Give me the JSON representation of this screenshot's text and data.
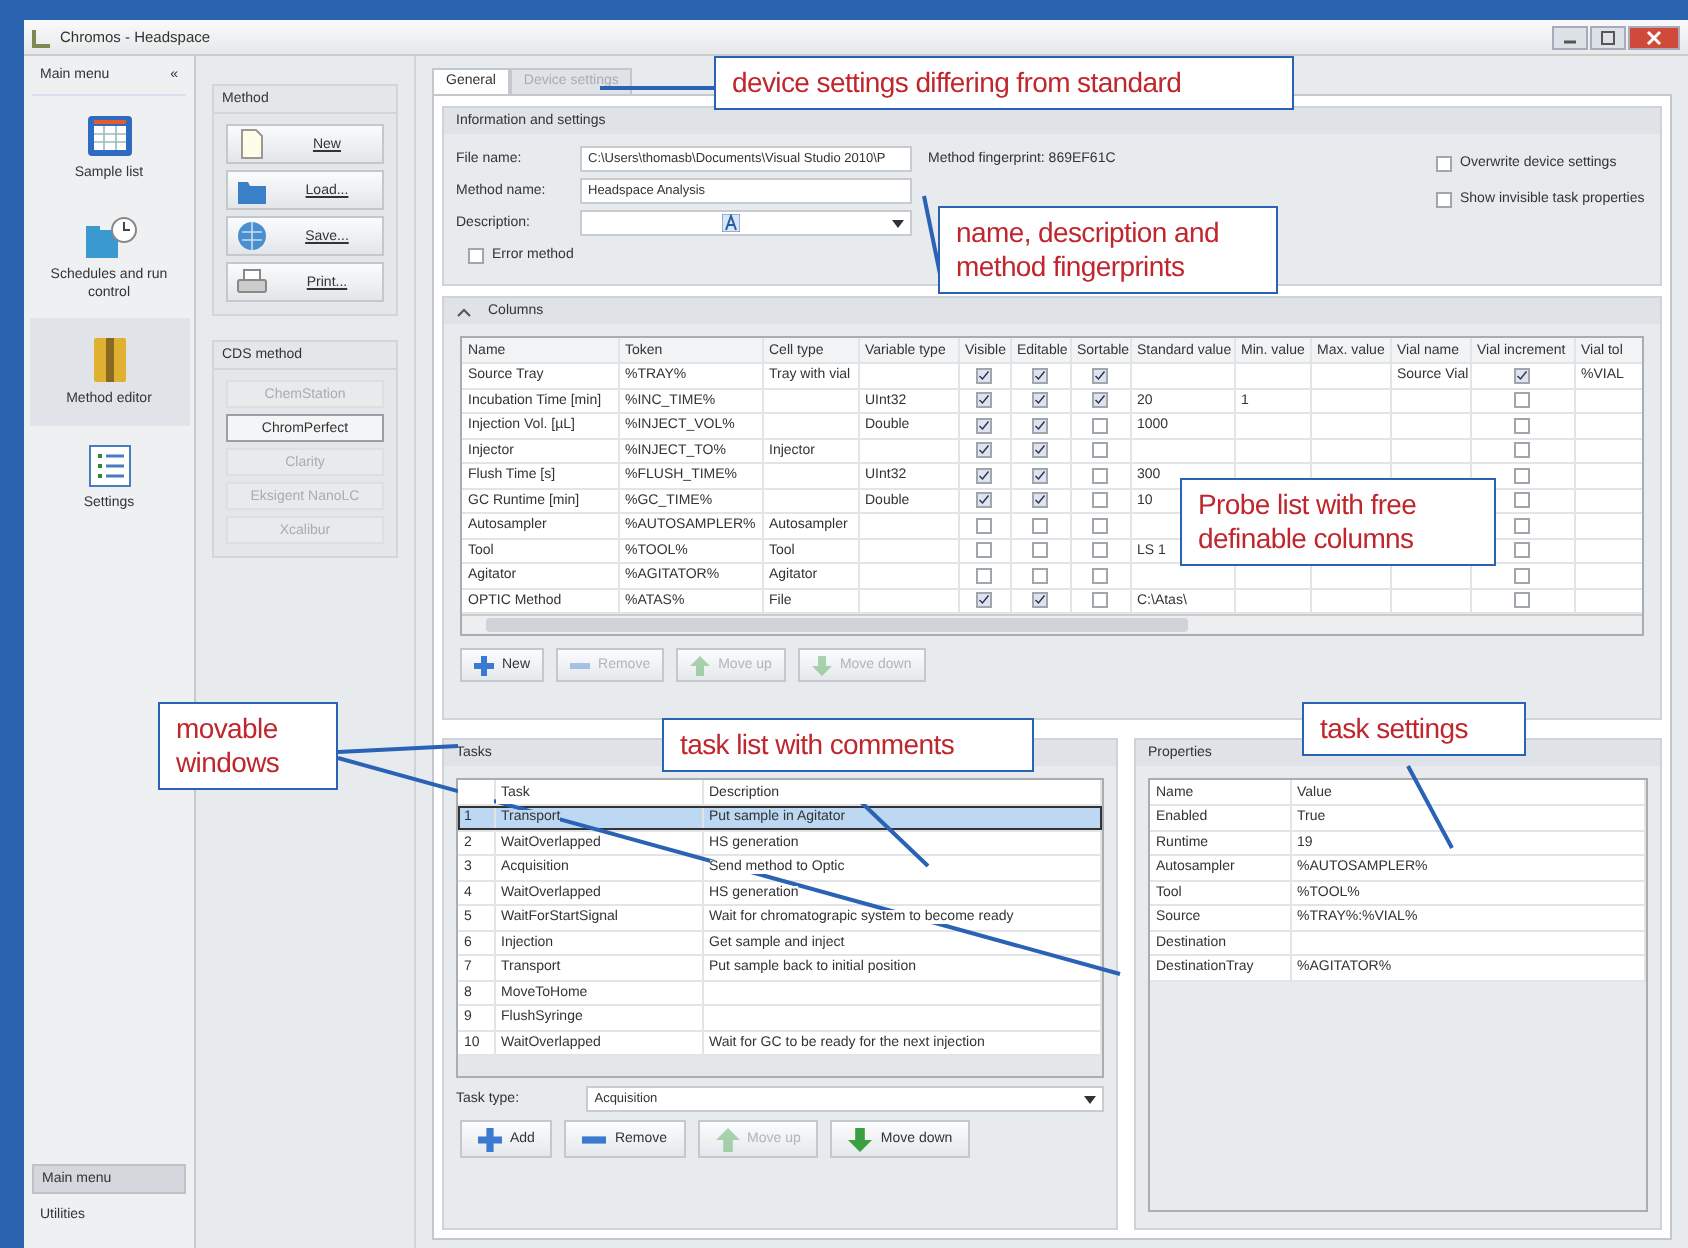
{
  "window": {
    "title": "Chromos - Headspace"
  },
  "sidebar": {
    "title": "Main menu",
    "collapse": "«",
    "items": [
      {
        "label": "Sample list",
        "selected": false
      },
      {
        "label": "Schedules and run control",
        "selected": false
      },
      {
        "label": "Method editor",
        "selected": true
      },
      {
        "label": "Settings",
        "selected": false
      }
    ],
    "bottom_items": [
      {
        "label": "Main menu",
        "selected": true
      },
      {
        "label": "Utilities",
        "selected": false
      }
    ]
  },
  "method_group": {
    "title": "Method",
    "buttons": [
      "New",
      "Load...",
      "Save...",
      "Print..."
    ]
  },
  "cds_group": {
    "title": "CDS method",
    "items": [
      {
        "label": "ChemStation",
        "selected": false
      },
      {
        "label": "ChromPerfect",
        "selected": true
      },
      {
        "label": "Clarity",
        "selected": false
      },
      {
        "label": "Eksigent NanoLC",
        "selected": false
      },
      {
        "label": "Xcalibur",
        "selected": false
      }
    ]
  },
  "tabs": [
    {
      "label": "General",
      "selected": true
    },
    {
      "label": "Device settings",
      "selected": false
    }
  ],
  "info": {
    "title": "Information and settings",
    "fields": [
      {
        "label": "File name:",
        "value": "C:\\Users\\thomasb\\Documents\\Visual Studio 2010\\P",
        "kind": "text"
      },
      {
        "label": "Method name:",
        "value": "Headspace Analysis",
        "kind": "text"
      },
      {
        "label": "Description:",
        "kind": "description"
      }
    ],
    "fingerprint": "Method fingerprint: 869EF61C",
    "error_method": {
      "label": "Error method",
      "checked": false
    },
    "options": [
      {
        "label": "Overwrite device settings",
        "checked": false
      },
      {
        "label": "Show invisible task properties",
        "checked": false
      }
    ]
  },
  "columns_group": {
    "title": "Columns",
    "expanded": true,
    "columns": [
      {
        "label": "Name",
        "kind": "text"
      },
      {
        "label": "Token",
        "kind": "text"
      },
      {
        "label": "Cell type",
        "kind": "text"
      },
      {
        "label": "Variable type",
        "kind": "text"
      },
      {
        "label": "Visible",
        "kind": "check"
      },
      {
        "label": "Editable",
        "kind": "check"
      },
      {
        "label": "Sortable",
        "kind": "check"
      },
      {
        "label": "Standard value",
        "kind": "text"
      },
      {
        "label": "Min. value",
        "kind": "text"
      },
      {
        "label": "Max. value",
        "kind": "text"
      },
      {
        "label": "Vial name",
        "kind": "text"
      },
      {
        "label": "Vial increment",
        "kind": "check"
      },
      {
        "label": "Vial tol",
        "kind": "text"
      }
    ],
    "rows": [
      {
        "cells": [
          "Source Tray",
          "%TRAY%",
          "Tray with vial",
          null,
          true,
          true,
          true,
          null,
          null,
          null,
          "Source Vial",
          true,
          "%VIAL"
        ]
      },
      {
        "cells": [
          "Incubation Time [min]",
          "%INC_TIME%",
          null,
          "UInt32",
          true,
          true,
          true,
          "20",
          "1",
          null,
          null,
          false,
          null
        ]
      },
      {
        "cells": [
          "Injection Vol. [µL]",
          "%INJECT_VOL%",
          null,
          "Double",
          true,
          true,
          false,
          "1000",
          null,
          null,
          null,
          false,
          null
        ]
      },
      {
        "cells": [
          "Injector",
          "%INJECT_TO%",
          "Injector",
          null,
          true,
          true,
          false,
          null,
          null,
          null,
          null,
          false,
          null
        ]
      },
      {
        "cells": [
          "Flush Time [s]",
          "%FLUSH_TIME%",
          null,
          "UInt32",
          true,
          true,
          false,
          "300",
          null,
          null,
          null,
          false,
          null
        ]
      },
      {
        "cells": [
          "GC Runtime [min]",
          "%GC_TIME%",
          null,
          "Double",
          true,
          true,
          false,
          "10",
          null,
          null,
          null,
          false,
          null
        ]
      },
      {
        "cells": [
          "Autosampler",
          "%AUTOSAMPLER%",
          "Autosampler",
          null,
          false,
          false,
          false,
          null,
          null,
          null,
          null,
          false,
          null
        ]
      },
      {
        "cells": [
          "Tool",
          "%TOOL%",
          "Tool",
          null,
          false,
          false,
          false,
          "LS 1",
          null,
          null,
          null,
          false,
          null
        ]
      },
      {
        "cells": [
          "Agitator",
          "%AGITATOR%",
          "Agitator",
          null,
          false,
          false,
          false,
          null,
          null,
          null,
          null,
          false,
          null
        ]
      },
      {
        "cells": [
          "OPTIC Method",
          "%ATAS%",
          "File",
          null,
          true,
          true,
          false,
          "C:\\Atas\\",
          null,
          null,
          null,
          false,
          null
        ]
      }
    ],
    "buttons": [
      {
        "label": "New",
        "kind": "add",
        "disabled": false
      },
      {
        "label": "Remove",
        "kind": "remove",
        "disabled": true
      },
      {
        "label": "Move up",
        "kind": "up",
        "disabled": true
      },
      {
        "label": "Move down",
        "kind": "down",
        "disabled": true
      }
    ]
  },
  "tasks": {
    "title": "Tasks",
    "columns": [
      "Task",
      "Description"
    ],
    "rows": [
      {
        "number": "1",
        "task": "Transport",
        "description": "Put sample in Agitator",
        "selected": true
      },
      {
        "number": "2",
        "task": "WaitOverlapped",
        "description": "HS generation",
        "selected": false
      },
      {
        "number": "3",
        "task": "Acquisition",
        "description": "Send method to Optic",
        "selected": false
      },
      {
        "number": "4",
        "task": "WaitOverlapped",
        "description": "HS generation",
        "selected": false
      },
      {
        "number": "5",
        "task": "WaitForStartSignal",
        "description": "Wait for chromatograpic system to become ready",
        "selected": false
      },
      {
        "number": "6",
        "task": "Injection",
        "description": "Get sample and inject",
        "selected": false
      },
      {
        "number": "7",
        "task": "Transport",
        "description": "Put sample back to initial position",
        "selected": false
      },
      {
        "number": "8",
        "task": "MoveToHome",
        "selected": false
      },
      {
        "number": "9",
        "task": "FlushSyringe",
        "selected": false
      },
      {
        "number": "10",
        "task": "WaitOverlapped",
        "description": "Wait for GC to be ready for the next injection",
        "selected": false
      }
    ],
    "task_type": {
      "label": "Task type:",
      "value": "Acquisition"
    },
    "buttons": [
      {
        "label": "Add",
        "kind": "add",
        "disabled": false
      },
      {
        "label": "Remove",
        "kind": "remove",
        "disabled": false
      },
      {
        "label": "Move up",
        "kind": "up",
        "disabled": true
      },
      {
        "label": "Move down",
        "kind": "down",
        "disabled": false
      }
    ]
  },
  "properties": {
    "title": "Properties",
    "columns": [
      "Name",
      "Value"
    ],
    "rows": [
      {
        "name": "Enabled",
        "value": "True"
      },
      {
        "name": "Runtime",
        "value": "19"
      },
      {
        "name": "Autosampler",
        "value": "%AUTOSAMPLER%"
      },
      {
        "name": "Tool",
        "value": "%TOOL%"
      },
      {
        "name": "Source",
        "value": "%TRAY%:%VIAL%"
      },
      {
        "name": "Destination"
      },
      {
        "name": "DestinationTray",
        "value": "%AGITATOR%"
      }
    ]
  },
  "callouts": [
    {
      "text": "device settings differing from standard"
    },
    {
      "text": "name, description and method fingerprints"
    },
    {
      "text": "Probe list with free definable columns"
    },
    {
      "text": "movable windows"
    },
    {
      "text": "task list with comments"
    },
    {
      "text": "task settings"
    }
  ]
}
